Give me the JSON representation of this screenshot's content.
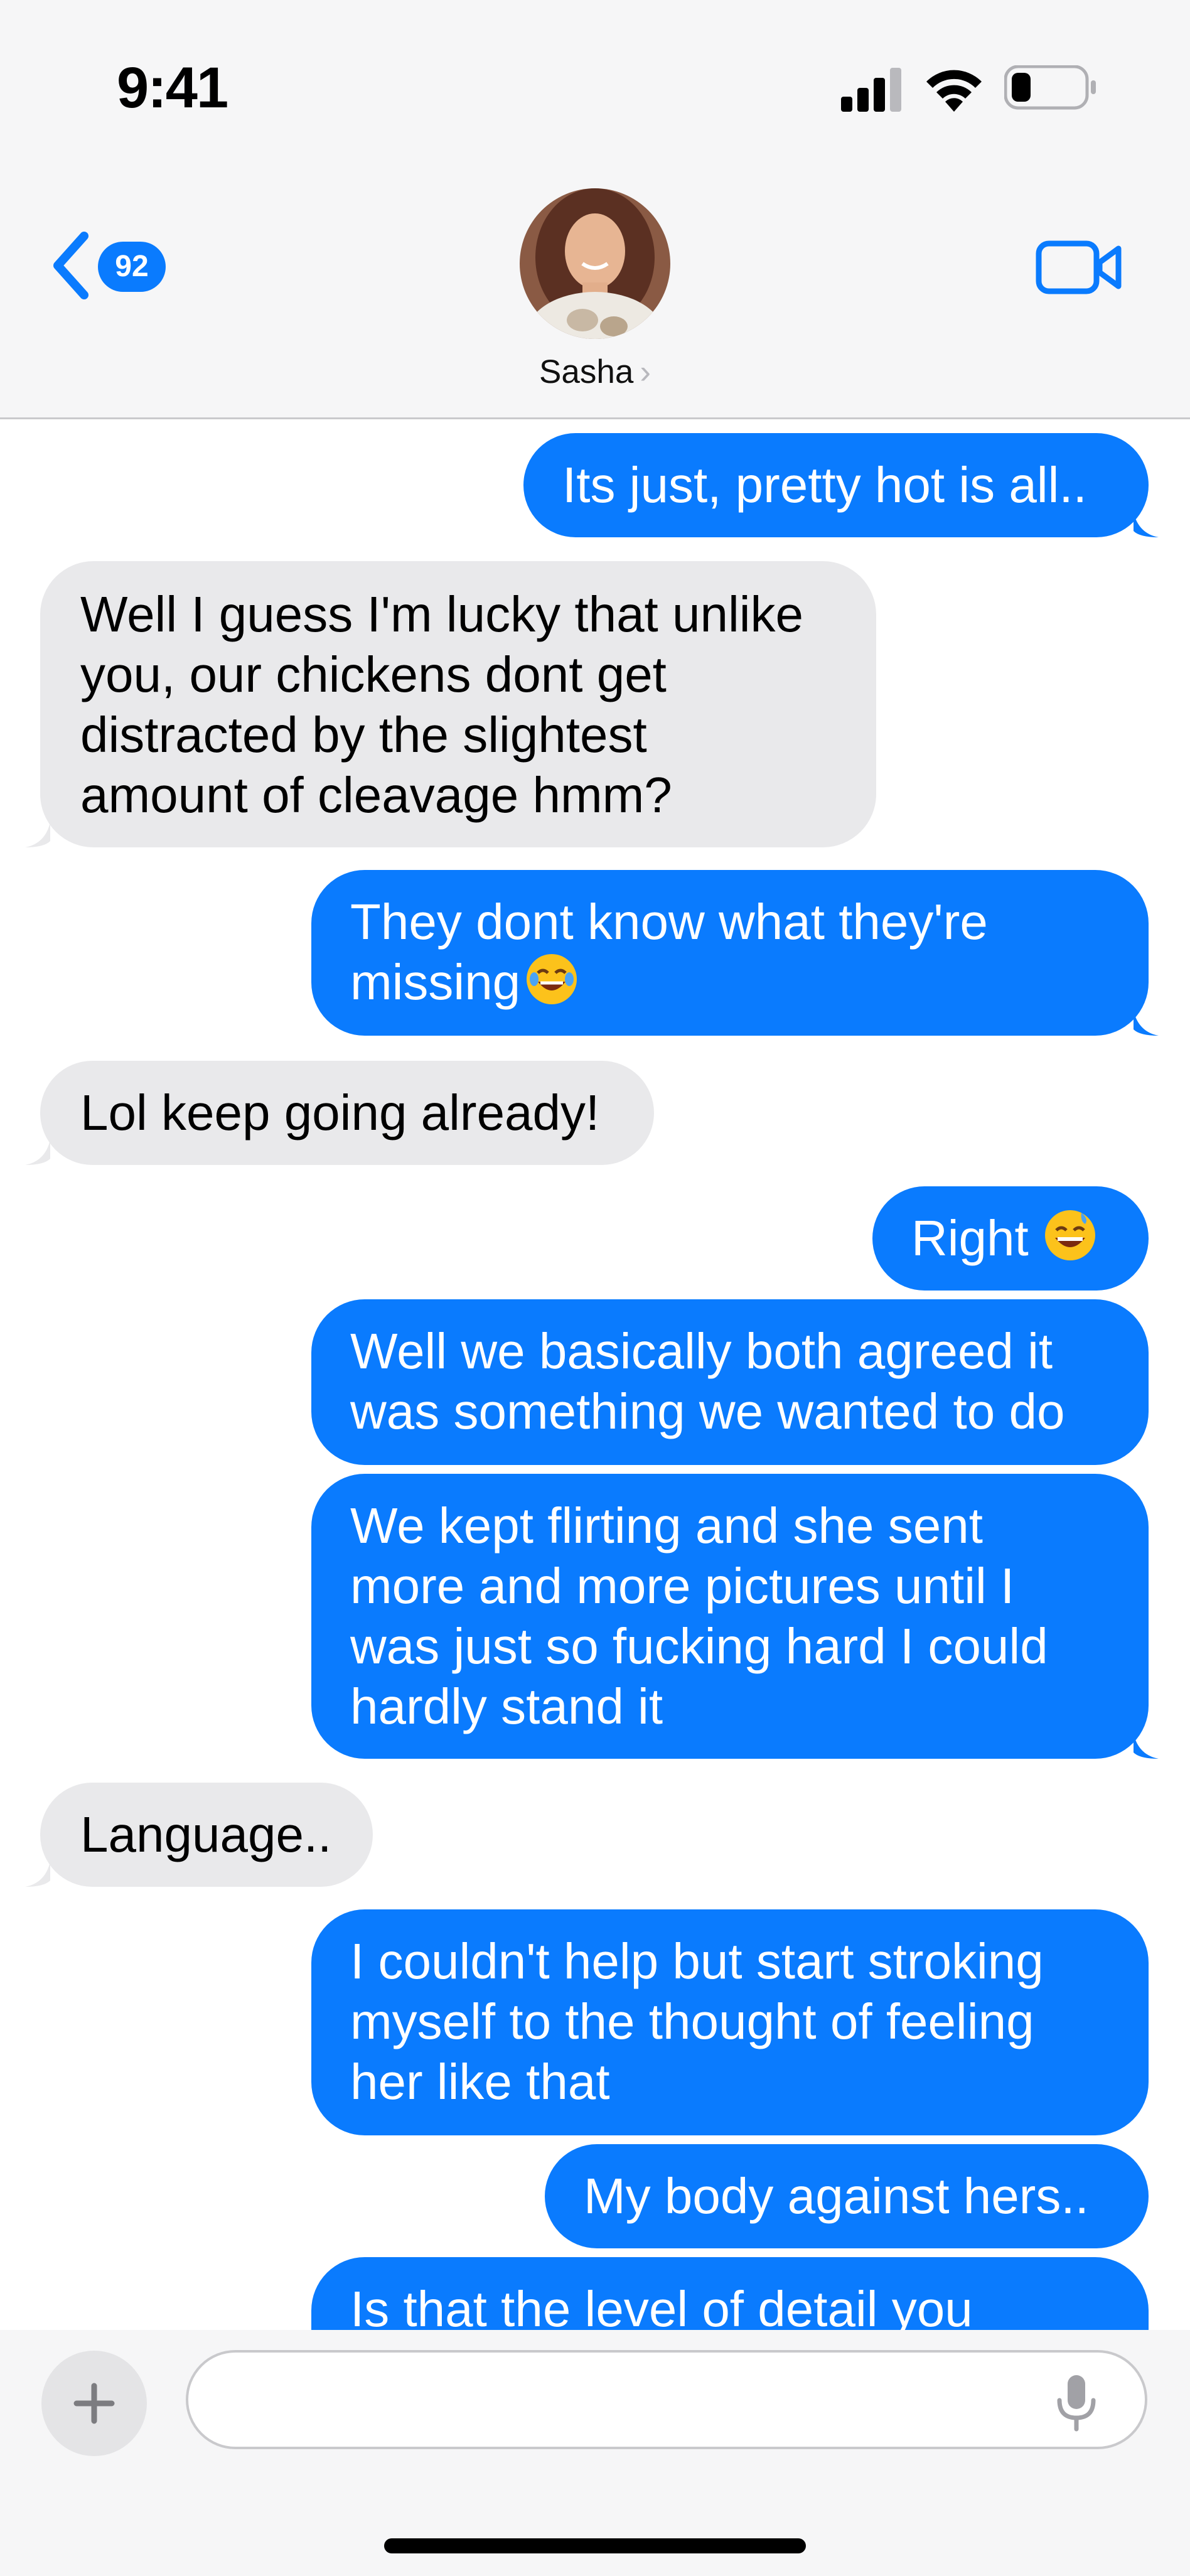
{
  "status_bar": {
    "time": "9:41"
  },
  "header": {
    "unread_count": "92",
    "contact_name": "Sasha",
    "contact_chevron": "›"
  },
  "messages": [
    {
      "text": "Its just, pretty hot is all.."
    },
    {
      "text": "Well I guess I'm lucky that unlike\nyou, our chickens dont get\ndistracted by the slightest\namount of cleavage hmm?"
    },
    {
      "text": "They dont know what they're\nmissing"
    },
    {
      "text": "Lol keep going already!"
    },
    {
      "text": "Right"
    },
    {
      "text": "Well we basically both agreed it\nwas something we wanted to do"
    },
    {
      "text": "We kept flirting and she sent\nmore and more pictures until I\nwas just so fucking hard I could\nhardly stand it"
    },
    {
      "text": "Language.."
    },
    {
      "text": "I couldn't help but start stroking\nmyself to the thought of feeling\nher like that"
    },
    {
      "text": "My body against hers.."
    },
    {
      "text": "Is that the level of detail you"
    }
  ],
  "icons": {
    "back": "chevron-left-icon",
    "video": "video-camera-icon",
    "plus": "plus-icon",
    "mic": "microphone-icon",
    "emoji_laugh": "face-with-tears-of-joy-emoji",
    "emoji_grin": "grinning-face-with-sweat-emoji"
  },
  "colors": {
    "outgoing": "#0a7bfe",
    "incoming": "#e9e9eb",
    "header_bg": "#f6f6f7"
  }
}
